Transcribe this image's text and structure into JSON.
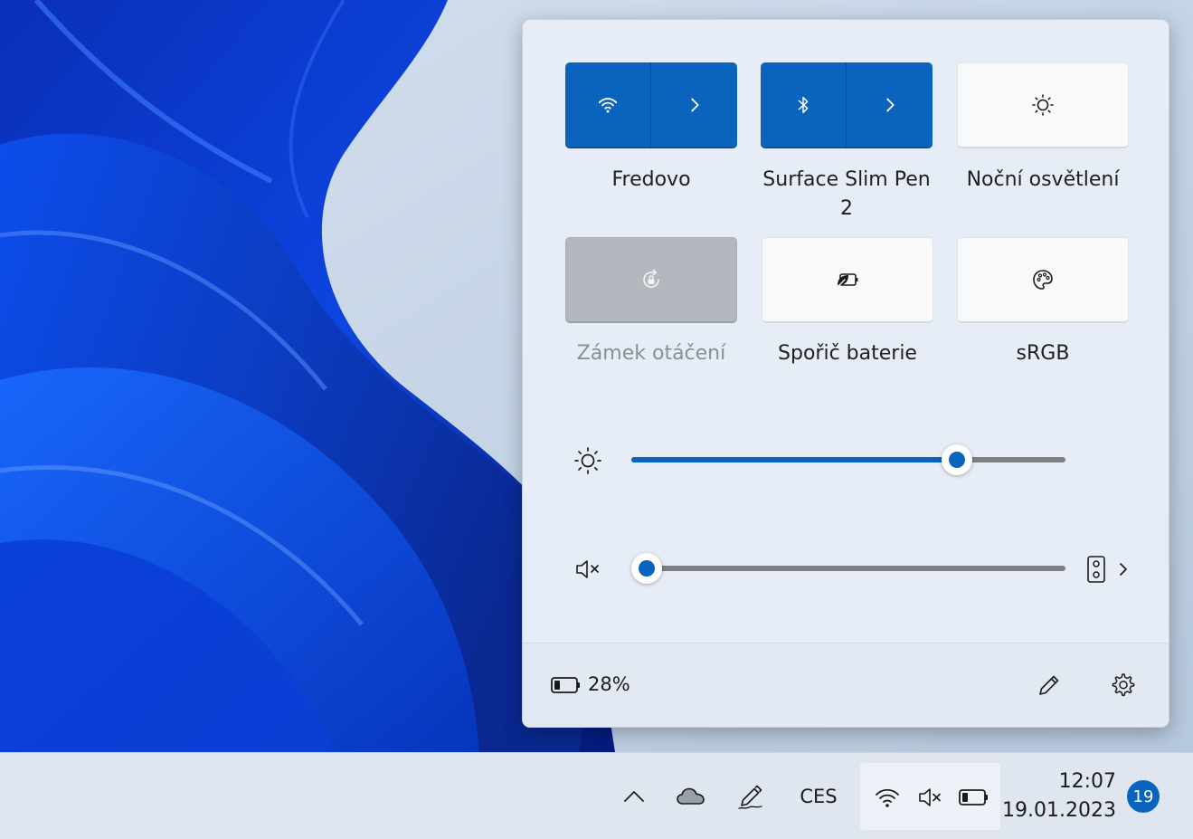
{
  "quick_settings": {
    "tiles": [
      {
        "label": "Fredovo",
        "icon": "wifi-icon",
        "state": "on",
        "has_chevron": true
      },
      {
        "label": "Surface Slim Pen 2",
        "icon": "bluetooth-icon",
        "state": "on",
        "has_chevron": true
      },
      {
        "label": "Noční osvětlení",
        "icon": "night-light-icon",
        "state": "off"
      },
      {
        "label": "Zámek otáčení",
        "icon": "rotation-lock-icon",
        "state": "disabled"
      },
      {
        "label": "Spořič baterie",
        "icon": "battery-saver-icon",
        "state": "off"
      },
      {
        "label": "sRGB",
        "icon": "palette-icon",
        "state": "off"
      }
    ],
    "brightness": {
      "icon": "brightness-icon",
      "value_percent": 75
    },
    "volume": {
      "icon": "speaker-muted-icon",
      "value_percent": 0,
      "output_icon": "speaker-device-icon"
    },
    "footer": {
      "battery_icon": "battery-icon",
      "battery_percent": "28%",
      "edit_icon": "pencil-icon",
      "settings_icon": "gear-icon"
    }
  },
  "taskbar": {
    "tray_icons": [
      "chevron-up-icon",
      "onedrive-cloud-icon",
      "pen-menu-icon"
    ],
    "language": "CES",
    "status_icons": [
      "wifi-icon",
      "speaker-muted-icon",
      "battery-icon"
    ],
    "time": "12:07",
    "date": "19.01.2023",
    "notification_count": "19"
  },
  "colors": {
    "accent": "#0a63bd",
    "panel_bg": "#e7edf6",
    "taskbar_bg": "#dfe6f0"
  }
}
